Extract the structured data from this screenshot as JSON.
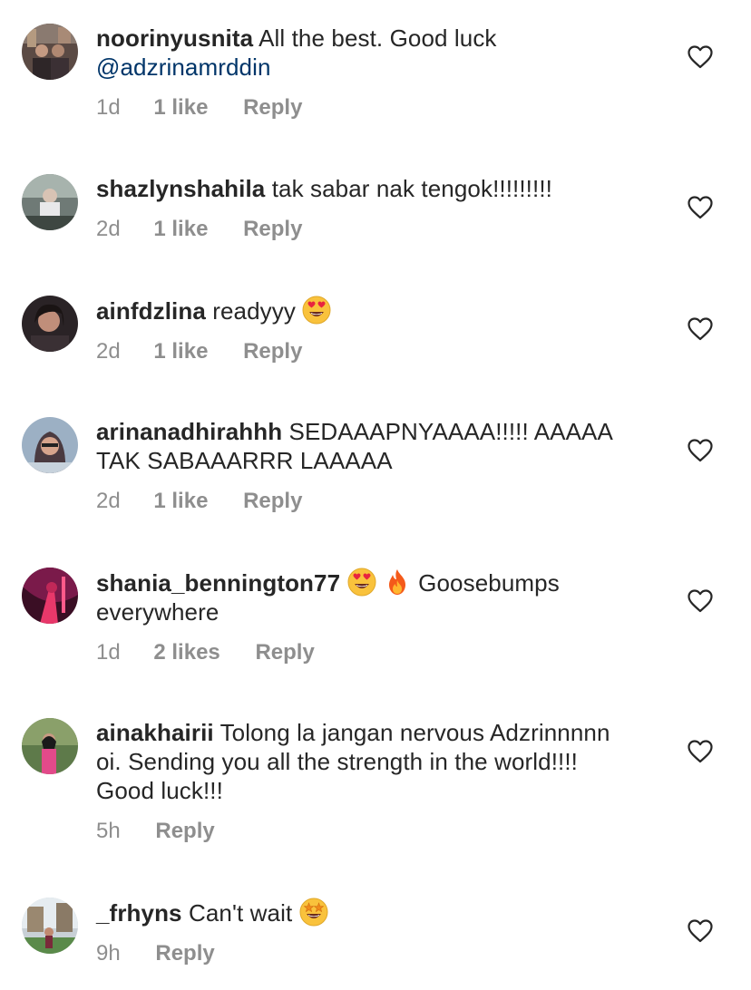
{
  "comments": [
    {
      "username": "noorinyusnita",
      "text": "All the best. Good luck",
      "mention": "@adzrinamrddin",
      "time": "1d",
      "likes": "1 like",
      "reply": "Reply"
    },
    {
      "username": "shazlynshahila",
      "text": "tak sabar nak tengok!!!!!!!!!",
      "time": "2d",
      "likes": "1 like",
      "reply": "Reply"
    },
    {
      "username": "ainfdzlina",
      "text": "readyyy",
      "emoji": [
        "heart-eyes-emoji"
      ],
      "time": "2d",
      "likes": "1 like",
      "reply": "Reply"
    },
    {
      "username": "arinanadhirahhh",
      "text": "SEDAAAPNYAAAA!!!!! AAAAA TAK SABAAARRR LAAAAA",
      "time": "2d",
      "likes": "1 like",
      "reply": "Reply"
    },
    {
      "username": "shania_bennington77",
      "emoji": [
        "heart-eyes-emoji",
        "fire-emoji"
      ],
      "text": "Goosebumps everywhere",
      "time": "1d",
      "likes": "2 likes",
      "reply": "Reply"
    },
    {
      "username": "ainakhairii",
      "text": "Tolong la jangan nervous Adzrinnnnn oi. Sending you all the strength in the world!!!! Good luck!!!",
      "time": "5h",
      "reply": "Reply"
    },
    {
      "username": "_frhyns",
      "text": "Can't wait",
      "emoji": [
        "star-struck-emoji"
      ],
      "time": "9h",
      "reply": "Reply"
    }
  ],
  "colors": {
    "text": "#262626",
    "meta": "#8e8e8e",
    "mention": "#003569",
    "heart_outline": "#8e8e8e"
  },
  "icons": {
    "like": "heart-outline-icon"
  }
}
